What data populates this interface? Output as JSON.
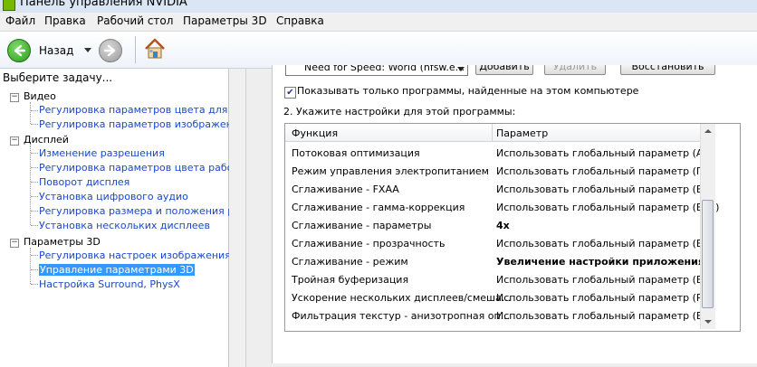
{
  "window": {
    "title": "Панель управления NVIDIA"
  },
  "menu": [
    "Файл",
    "Правка",
    "Рабочий стол",
    "Параметры 3D",
    "Справка"
  ],
  "toolbar": {
    "back_label": "Назад"
  },
  "left_pane": {
    "task_title": "Выберите задачу...",
    "categories": [
      {
        "label": "Видео",
        "items": [
          {
            "label": "Регулировка параметров цвета для вид"
          },
          {
            "label": "Регулировка параметров изображения д"
          }
        ]
      },
      {
        "label": "Дисплей",
        "items": [
          {
            "label": "Изменение разрешения"
          },
          {
            "label": "Регулировка параметров цвета рабочег"
          },
          {
            "label": "Поворот дисплея"
          },
          {
            "label": "Установка цифрового аудио"
          },
          {
            "label": "Регулировка размера и положения рабо"
          },
          {
            "label": "Установка нескольких дисплеев"
          }
        ]
      },
      {
        "label": "Параметры 3D",
        "items": [
          {
            "label": "Регулировка настроек изображения с пр"
          },
          {
            "label": "Управление параметрами 3D",
            "selected": true
          },
          {
            "label": "Настройка Surround, PhysX"
          }
        ]
      }
    ]
  },
  "program_settings": {
    "selected_program": "Need for Speed: World (nfsw.e...",
    "add_button": "Добавить",
    "remove_button": "Удалить",
    "restore_button": "Восстановить",
    "show_only_found_label": "Показывать только программы, найденные на этом компьютере",
    "show_only_found_checked": true,
    "step2_label": "2. Укажите настройки для этой программы:",
    "columns": [
      "Функция",
      "Параметр"
    ],
    "rows": [
      {
        "feature": "Потоковая оптимизация",
        "value": "Использовать глобальный параметр (А..."
      },
      {
        "feature": "Режим управления электропитанием",
        "value": "Использовать глобальный параметр (П..."
      },
      {
        "feature": "Сглаживание - FXAA",
        "value": "Использовать глобальный параметр (В..."
      },
      {
        "feature": "Сглаживание - гамма-коррекция",
        "value": "Использовать глобальный параметр (Вкл)"
      },
      {
        "feature": "Сглаживание - параметры",
        "value": "4x",
        "bold": true
      },
      {
        "feature": "Сглаживание - прозрачность",
        "value": "Использовать глобальный параметр (В..."
      },
      {
        "feature": "Сглаживание - режим",
        "value": "Увеличение настройки приложения",
        "bold": true
      },
      {
        "feature": "Тройная буферизация",
        "value": "Использовать глобальный параметр (В..."
      },
      {
        "feature": "Ускорение нескольких дисплеев/смеша...",
        "value": "Использовать глобальный параметр (Р..."
      },
      {
        "feature": "Фильтрация текстур - анизотропная оп...",
        "value": "Использовать глобальный параметр (В..."
      }
    ]
  },
  "colors": {
    "link": "#1a47c8",
    "selection": "#3399ff",
    "nvidia_green": "#76b900"
  }
}
